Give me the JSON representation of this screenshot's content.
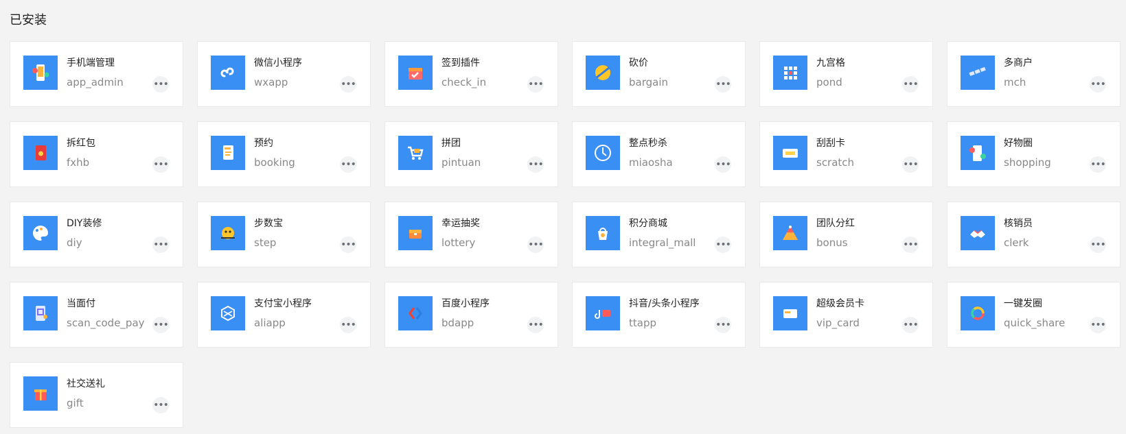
{
  "section_title": "已安装",
  "plugins": [
    {
      "name": "手机端管理",
      "code": "app_admin",
      "icon": "phone-admin-icon"
    },
    {
      "name": "微信小程序",
      "code": "wxapp",
      "icon": "wechat-miniprogram-icon"
    },
    {
      "name": "签到插件",
      "code": "check_in",
      "icon": "calendar-check-icon"
    },
    {
      "name": "砍价",
      "code": "bargain",
      "icon": "bargain-knife-icon"
    },
    {
      "name": "九宫格",
      "code": "pond",
      "icon": "nine-grid-icon"
    },
    {
      "name": "多商户",
      "code": "mch",
      "icon": "multi-merchant-icon"
    },
    {
      "name": "拆红包",
      "code": "fxhb",
      "icon": "red-envelope-icon"
    },
    {
      "name": "预约",
      "code": "booking",
      "icon": "booking-note-icon"
    },
    {
      "name": "拼团",
      "code": "pintuan",
      "icon": "shopping-cart-icon"
    },
    {
      "name": "整点秒杀",
      "code": "miaosha",
      "icon": "clock-flash-icon"
    },
    {
      "name": "刮刮卡",
      "code": "scratch",
      "icon": "scratch-card-icon"
    },
    {
      "name": "好物圈",
      "code": "shopping",
      "icon": "phone-share-icon"
    },
    {
      "name": "DIY装修",
      "code": "diy",
      "icon": "paint-palette-icon"
    },
    {
      "name": "步数宝",
      "code": "step",
      "icon": "step-mascot-icon"
    },
    {
      "name": "幸运抽奖",
      "code": "lottery",
      "icon": "treasure-chest-icon"
    },
    {
      "name": "积分商城",
      "code": "integral_mall",
      "icon": "points-mall-icon"
    },
    {
      "name": "团队分红",
      "code": "bonus",
      "icon": "pyramid-bonus-icon"
    },
    {
      "name": "核销员",
      "code": "clerk",
      "icon": "handshake-icon"
    },
    {
      "name": "当面付",
      "code": "scan_code_pay",
      "icon": "scan-pay-icon"
    },
    {
      "name": "支付宝小程序",
      "code": "aliapp",
      "icon": "alipay-miniprogram-icon"
    },
    {
      "name": "百度小程序",
      "code": "bdapp",
      "icon": "baidu-miniprogram-icon"
    },
    {
      "name": "抖音/头条小程序",
      "code": "ttapp",
      "icon": "douyin-miniprogram-icon"
    },
    {
      "name": "超级会员卡",
      "code": "vip_card",
      "icon": "vip-card-icon"
    },
    {
      "name": "一键发圈",
      "code": "quick_share",
      "icon": "quick-share-ring-icon"
    },
    {
      "name": "社交送礼",
      "code": "gift",
      "icon": "gift-box-icon"
    }
  ],
  "more_label": "•••",
  "colors": {
    "icon_bg": "#3a8ff5",
    "page_bg": "#f3f3f3",
    "card_bg": "#ffffff"
  }
}
